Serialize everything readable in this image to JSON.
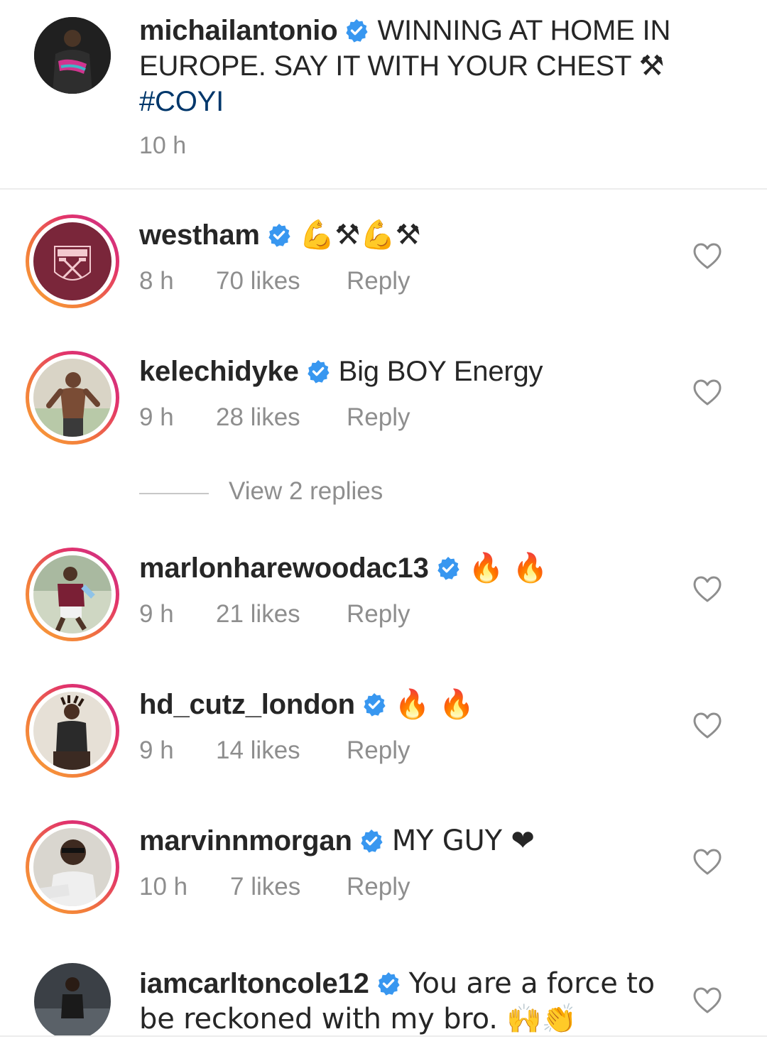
{
  "caption": {
    "username": "michailantonio",
    "text_line1": "WINNING AT HOME IN",
    "text_line2": "EUROPE. SAY IT WITH YOUR CHEST ⚒",
    "hashtag": "#COYI",
    "time": "10 h"
  },
  "comments": [
    {
      "username": "westham",
      "text": "💪⚒💪⚒",
      "time": "8 h",
      "likes": "70 likes",
      "reply": "Reply"
    },
    {
      "username": "kelechidyke",
      "text": "Big BOY Energy",
      "time": "9 h",
      "likes": "28 likes",
      "reply": "Reply"
    },
    {
      "username": "marlonharewoodac13",
      "text": "🔥 🔥",
      "time": "9 h",
      "likes": "21 likes",
      "reply": "Reply"
    },
    {
      "username": "hd_cutz_london",
      "text": "🔥 🔥",
      "time": "9 h",
      "likes": "14 likes",
      "reply": "Reply"
    },
    {
      "username": "marvinnmorgan",
      "text": "MY GUY ❤",
      "time": "10 h",
      "likes": "7 likes",
      "reply": "Reply"
    },
    {
      "username": "iamcarltoncole12",
      "text": "You are a force to be reckoned with my bro. 🙌👏"
    }
  ],
  "view_replies": "View 2 replies",
  "colors": {
    "verified": "#3897f0",
    "hashtag": "#00376b",
    "meta": "#8e8e8e",
    "ring": "#e2336b"
  },
  "icons": {
    "verified": "verified-badge-icon",
    "heart": "heart-outline-icon",
    "crest": "west-ham-crest-icon"
  }
}
